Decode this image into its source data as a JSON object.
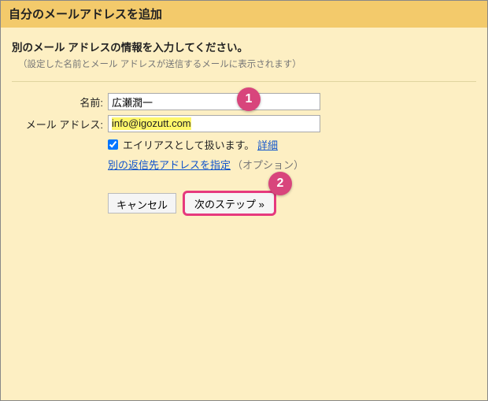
{
  "title": "自分のメールアドレスを追加",
  "subheader": {
    "main": "別のメール アドレスの情報を入力してください。",
    "note": "（設定した名前とメール アドレスが送信するメールに表示されます）"
  },
  "form": {
    "name_label": "名前:",
    "name_value": "広瀬潤一",
    "email_label": "メール アドレス:",
    "email_value": "info@igozutt.com",
    "alias_checked": true,
    "alias_label": "エイリアスとして扱います。",
    "alias_detail_link": "詳細",
    "replyto_link": "別の返信先アドレスを指定",
    "replyto_optional": "（オプション）"
  },
  "buttons": {
    "cancel": "キャンセル",
    "next": "次のステップ »"
  },
  "callouts": {
    "c1": "1",
    "c2": "2"
  }
}
